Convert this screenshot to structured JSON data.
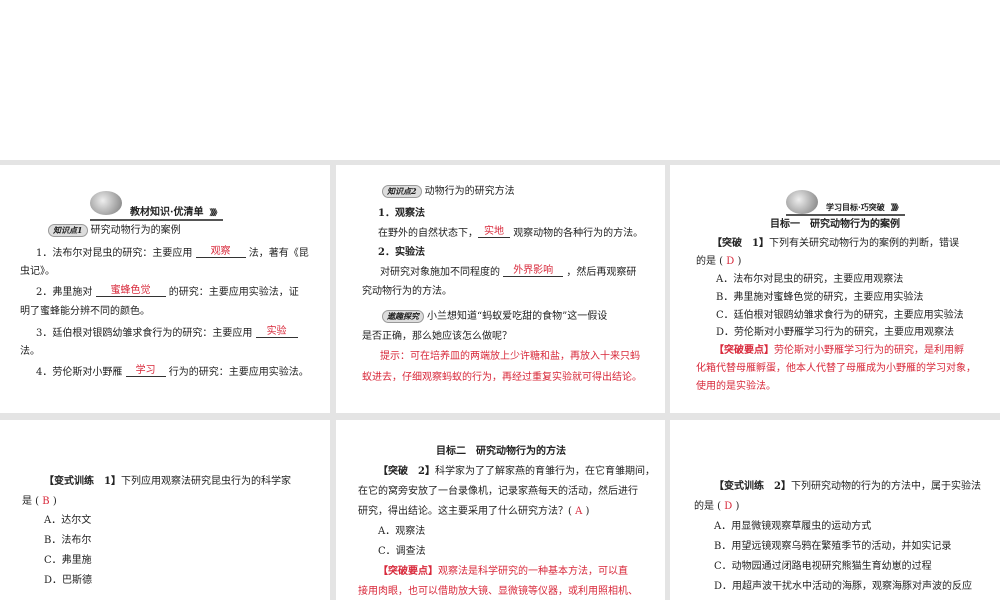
{
  "p1": {
    "header": "教材知识·优清单",
    "arrows": "》》》",
    "kp_tag": "知识点1",
    "kp_title": "研究动物行为的案例",
    "l1a": "1．法布尔对昆虫的研究：主要应用",
    "l1ans": "观察",
    "l1b": "法，著有《昆",
    "l1c": "虫记》。",
    "l2a": "2．弗里施对",
    "l2ans": "蜜蜂色觉",
    "l2b": "的研究：主要应用实验法，证",
    "l2c": "明了蜜蜂能分辨不同的颜色。",
    "l3a": "3．廷伯根对银鸥幼雏求食行为的研究：主要应用",
    "l3ans": "实验",
    "l3c": "法。",
    "l4a": "4．劳伦斯对小野雁",
    "l4ans": "学习",
    "l4b": "行为的研究：主要应用实验法。"
  },
  "p2": {
    "kp_tag": "知识点2",
    "kp_title": "动物行为的研究方法",
    "h1": "1．观察法",
    "l1a": "在野外的自然状态下，",
    "l1ans": "实地",
    "l1b": "观察动物的各种行为的方法。",
    "h2": "2．实验法",
    "l2a": "对研究对象施加不同程度的",
    "l2ans": "外界影响",
    "l2b": "，然后再观察研",
    "l2c": "究动物行为的方法。",
    "fun_tag": "遨趣探究",
    "q1": "小兰想知道“蚂蚁爱吃甜的食物”这一假设",
    "q2": "是否正确，那么她应该怎么做呢？",
    "a1": "提示：可在培养皿的两端放上少许糖和盐，再放入十来只蚂",
    "a2": "蚁进去，仔细观察蚂蚁的行为，再经过重复实验就可得出结论。"
  },
  "p3": {
    "header": "学习目标·巧突破",
    "arrows": "》》》",
    "title": "目标一　研究动物行为的案例",
    "q_tag": "【突破　1】",
    "q1": "下列有关研究动物行为的案例的判断，错误",
    "q2a": "的是 (",
    "ans": "D",
    "q2b": ")",
    "opts": [
      "A．法布尔对昆虫的研究，主要应用观察法",
      "B．弗里施对蜜蜂色觉的研究，主要应用实验法",
      "C．廷伯根对银鸥幼雏求食行为的研究，主要应用实验法",
      "D．劳伦斯对小野雁学习行为的研究，主要应用观察法"
    ],
    "key_tag": "【突破要点】",
    "k1": "劳伦斯对小野雁学习行为的研究，是利用孵",
    "k2": "化箱代替母雁孵蛋，他本人代替了母雁成为小野雁的学习对象，",
    "k3": "使用的是实验法。"
  },
  "p4": {
    "q_tag": "【变式训练　1】",
    "q1": "下列应用观察法研究昆虫行为的科学家",
    "q2a": "是 (",
    "ans": "B",
    "q2b": ")",
    "opts": [
      "A．达尔文",
      "B．法布尔",
      "C．弗里施",
      "D．巴斯德"
    ]
  },
  "p5": {
    "title": "目标二　研究动物行为的方法",
    "q_tag": "【突破　2】",
    "q1": "科学家为了了解家燕的育雏行为，在它育雏期间，",
    "q2": "在它的窝旁安放了一台录像机，记录家燕每天的活动，然后进行",
    "q3a": "研究，得出结论。这主要采用了什么研究方法？(",
    "ans": "A",
    "q3b": ")",
    "opts": [
      "A．观察法",
      "C．调查法"
    ],
    "key_tag": "【突破要点】",
    "k1": "观察法是科学研究的一种基本方法，可以直",
    "k2": "接用肉眼，也可以借助放大镜、显微镜等仪器，或利用照相机、"
  },
  "p6": {
    "q_tag": "【变式训练　2】",
    "q1": "下列研究动物的行为的方法中，属于实验法",
    "q2a": "的是 (",
    "ans": "D",
    "q2b": ")",
    "opts": [
      "A．用显微镜观察草履虫的运动方式",
      "B．用望远镜观察乌鸦在繁殖季节的活动，并如实记录",
      "C．动物园通过闭路电视研究熊猫生育幼崽的过程",
      "D．用超声波干扰水中活动的海豚，观察海豚对声波的反应"
    ]
  }
}
